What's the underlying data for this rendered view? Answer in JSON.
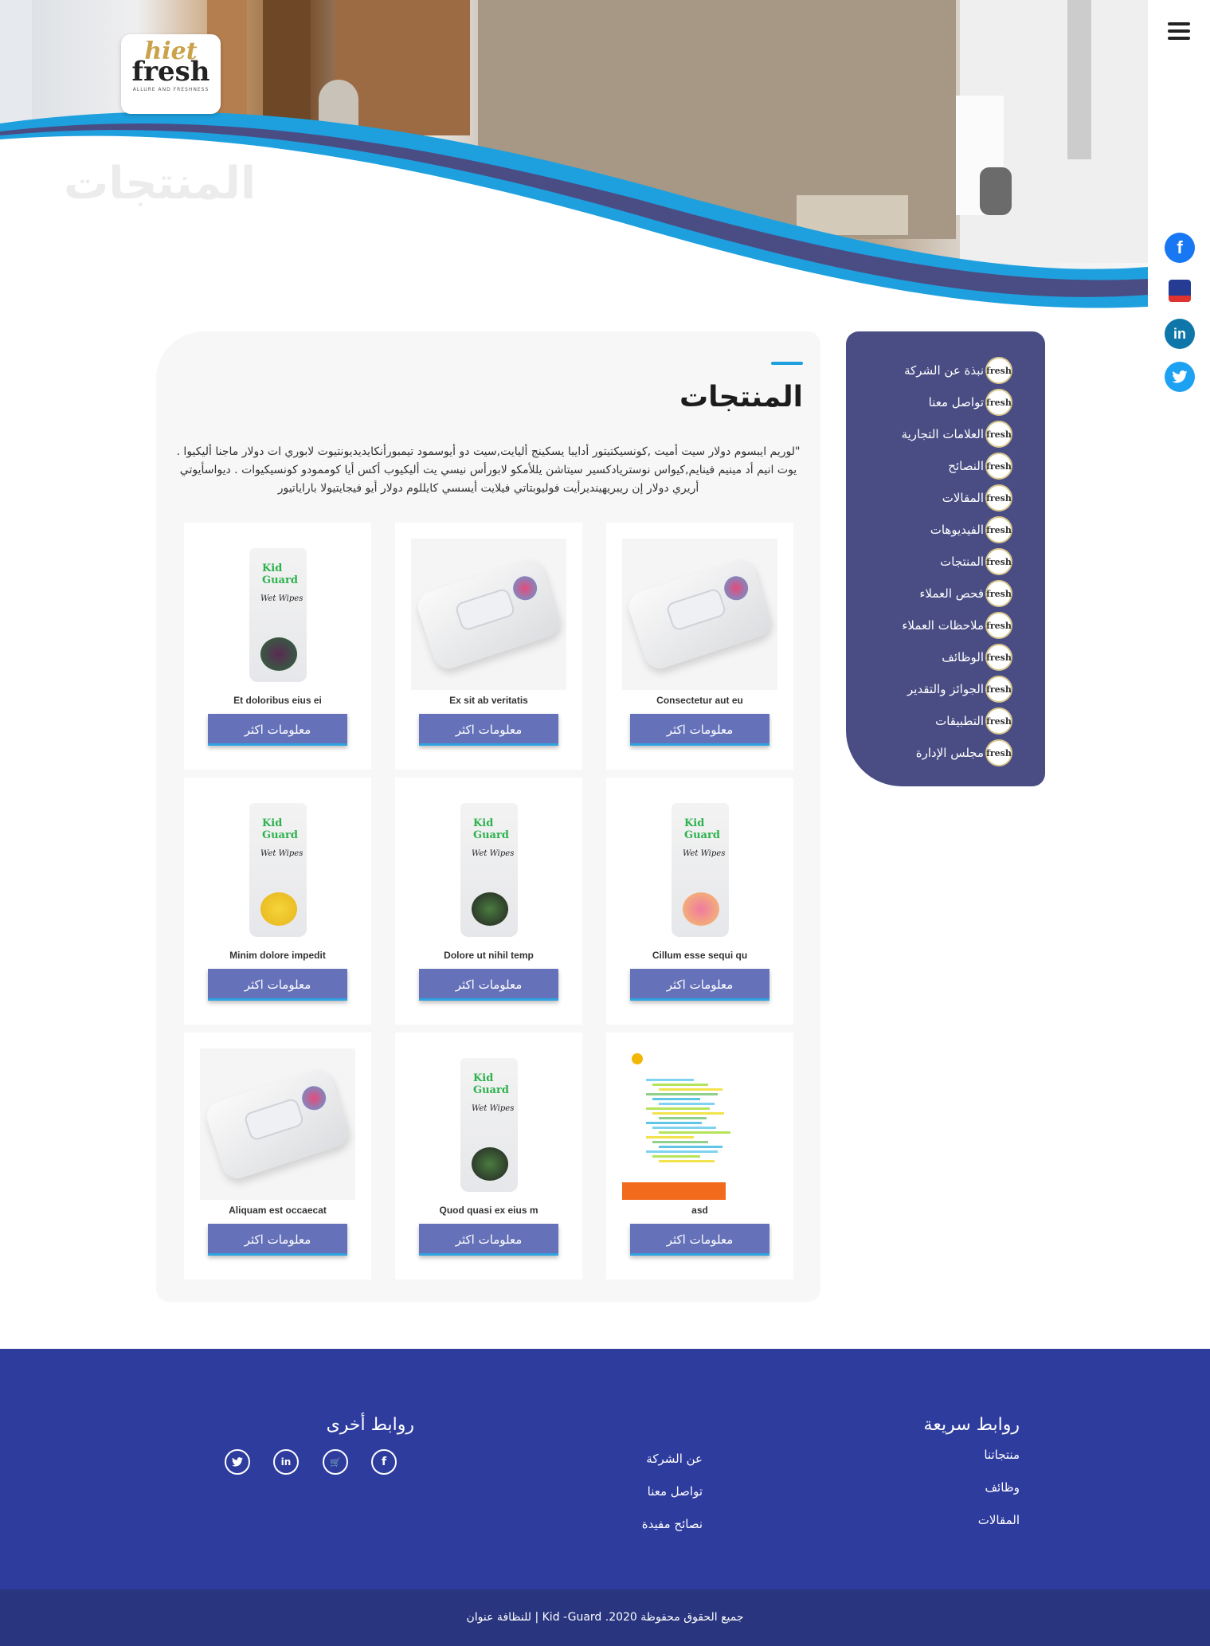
{
  "hero": {
    "title": "المنتجات",
    "logo": {
      "line1": "hiet",
      "line2": "fresh",
      "tagline": "ALLURE AND FRESHNESS"
    }
  },
  "side_social": [
    "facebook-icon",
    "shop-cart-icon",
    "linkedin-icon",
    "twitter-icon"
  ],
  "sidebar": {
    "items": [
      {
        "label": "نبذة عن الشركة"
      },
      {
        "label": "تواصل معنا"
      },
      {
        "label": "العلامات التجارية"
      },
      {
        "label": "النصائح"
      },
      {
        "label": "المقالات"
      },
      {
        "label": "الفيديوهات"
      },
      {
        "label": "المنتجات"
      },
      {
        "label": "فحص العملاء"
      },
      {
        "label": "ملاحظات العملاء"
      },
      {
        "label": "الوظائف"
      },
      {
        "label": "الجوائز والتقدير"
      },
      {
        "label": "التطبيقات"
      },
      {
        "label": "مجلس الإدارة"
      }
    ]
  },
  "main": {
    "heading": "المنتجات",
    "intro": "\"لوريم ايبسوم دولار سيت أميت ,كونسيكتيتور أدايبا يسكينج أليايت,سيت دو أيوسمود تيمبورأنكايديديونتيوت لابوري ات دولار ماجنا أليكيوا . يوت انيم أد مينيم فينايم,كيواس نوستريادكسير سيتاشن يللأمكو لابورأس نيسي يت أليكيوب أكس أيا كوممودو كونسيكيوات . ديواسأيوتي أريري دولار إن ريبريهينديرأيت فوليوبتاتي فيلايت أيسسي كايللوم دولار أيو فيجايتيولا باراياتيور",
    "more_label": "معلومات اكثر",
    "products": [
      {
        "name": "Consectetur aut eu",
        "image": "wipes-pack"
      },
      {
        "name": "Ex sit ab veritatis",
        "image": "wipes-pack"
      },
      {
        "name": "Et doloribus eius ei",
        "image": "pouch-berries"
      },
      {
        "name": "Cillum esse sequi qu",
        "image": "pouch-flowers"
      },
      {
        "name": "Dolore ut nihil temp",
        "image": "pouch-cartoon"
      },
      {
        "name": "Minim dolore impedit",
        "image": "pouch-lemon"
      },
      {
        "name": "asd",
        "image": "document"
      },
      {
        "name": "Quod quasi ex eius m",
        "image": "pouch-cartoon"
      },
      {
        "name": "Aliquam est occaecat",
        "image": "wipes-pack"
      }
    ]
  },
  "footer": {
    "quick_links": {
      "title": "روابط سريعة",
      "items": [
        "منتجاتنا",
        "وظائف",
        "المقالات"
      ]
    },
    "middle_links": {
      "items": [
        "عن الشركة",
        "تواصل معنا",
        "نصائح مفيدة"
      ]
    },
    "other_links": {
      "title": "روابط أخرى",
      "social": [
        "facebook-icon",
        "shop-cart-icon",
        "linkedin-icon",
        "twitter-icon"
      ]
    },
    "copyright": "جميع الحقوق محفوظة 2020. Kid -Guard | للنظافة عنوان"
  },
  "colors": {
    "sidebar_bg": "#4a4d84",
    "button_bg": "#6571b9",
    "accent": "#1ea0df",
    "footer_bg": "#2e3c9e",
    "copyright_bg": "#29357f"
  }
}
